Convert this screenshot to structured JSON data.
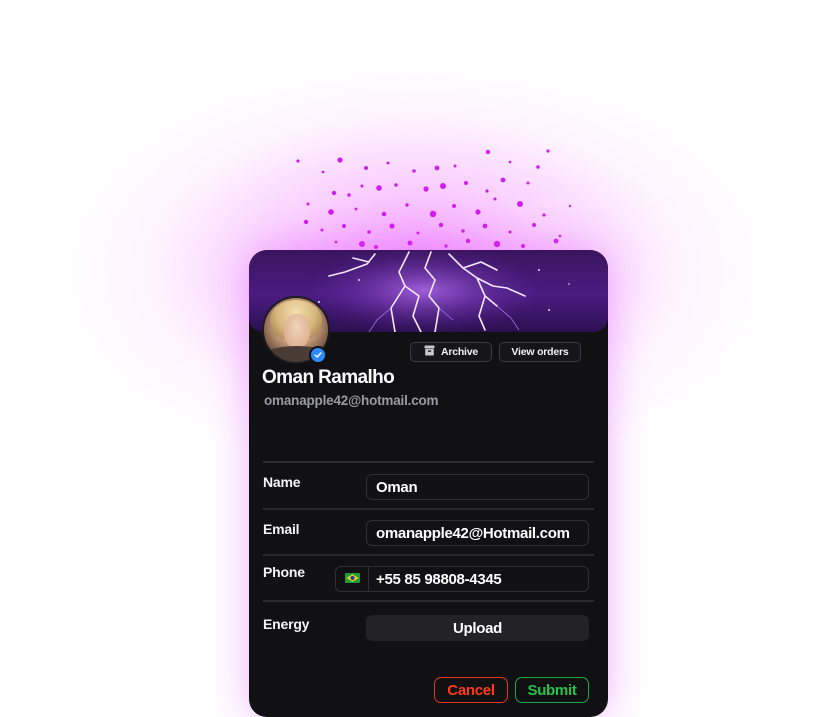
{
  "profile": {
    "name": "Oman Ramalho",
    "email": "omanapple42@hotmail.com"
  },
  "actions": {
    "archive_label": "Archive",
    "view_orders_label": "View orders"
  },
  "form": {
    "name_label": "Name",
    "name_value": "Oman",
    "email_label": "Email",
    "email_value": "omanapple42@Hotmail.com",
    "phone_label": "Phone",
    "phone_country_flag": "brazil-flag-icon",
    "phone_value": "+55 85 98808-4345",
    "energy_label": "Energy",
    "upload_label": "Upload"
  },
  "footer": {
    "cancel_label": "Cancel",
    "submit_label": "Submit"
  },
  "colors": {
    "accent_glow": "#e93cff",
    "card_bg": "#111114",
    "cancel": "#ff3a1d",
    "submit": "#26c24f",
    "verified_badge": "#2f8cff"
  },
  "icons": {
    "archive": "archive-box-icon",
    "verified": "verified-check-icon",
    "flag": "brazil-flag-icon"
  }
}
